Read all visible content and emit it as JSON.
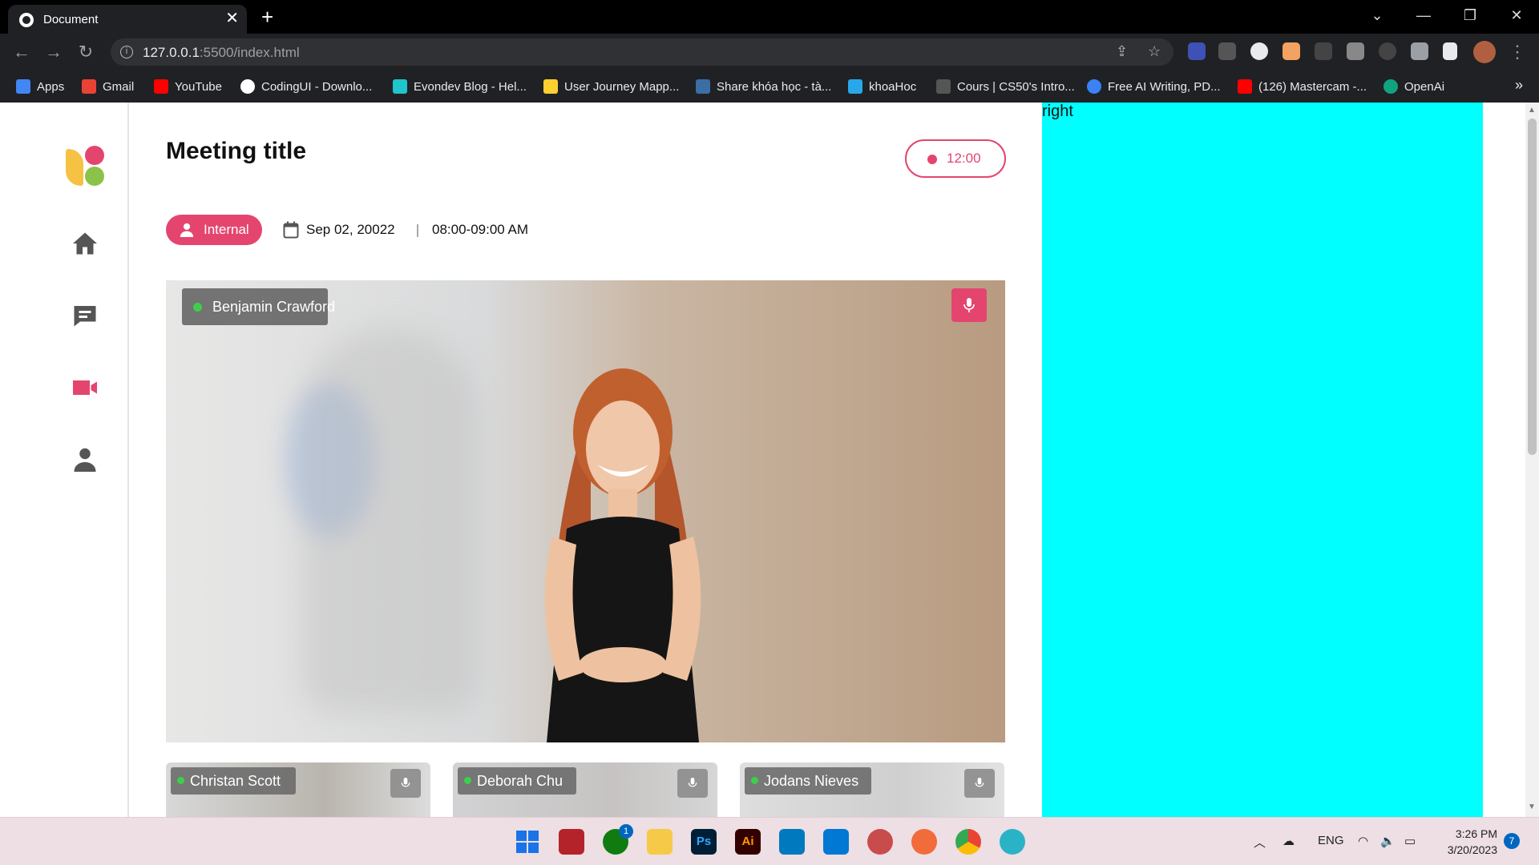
{
  "browser": {
    "tab_title": "Document",
    "tab_close": "✕",
    "new_tab": "+",
    "url_host": "127.0.0.1",
    "url_path": ":5500/index.html",
    "bookmarks": [
      {
        "label": "Apps",
        "icon": "apps-grid-icon",
        "color": "#4285f4"
      },
      {
        "label": "Gmail",
        "icon": "gmail-icon",
        "color": "#ea4335"
      },
      {
        "label": "YouTube",
        "icon": "youtube-icon",
        "color": "#ff0000"
      },
      {
        "label": "CodingUI - Downlo...",
        "icon": "codingui-icon",
        "color": "#ffffff"
      },
      {
        "label": "Evondev Blog - Hel...",
        "icon": "evondev-icon",
        "color": "#20c4cb"
      },
      {
        "label": "User Journey Mapp...",
        "icon": "miro-icon",
        "color": "#ffd02f"
      },
      {
        "label": "Share khóa học - tà...",
        "icon": "share-icon",
        "color": "#3a6ea5"
      },
      {
        "label": "khoaHoc",
        "icon": "onedrive-icon",
        "color": "#28a8ea"
      },
      {
        "label": "Cours | CS50's Intro...",
        "icon": "edx-icon",
        "color": "#bbbbbb"
      },
      {
        "label": "Free AI Writing, PD...",
        "icon": "ai-writing-icon",
        "color": "#3b82f6"
      },
      {
        "label": "(126) Mastercam -...",
        "icon": "youtube-icon",
        "color": "#ff0000"
      },
      {
        "label": "OpenAi",
        "icon": "openai-icon",
        "color": "#10a37f"
      }
    ],
    "bookmarks_more": "»"
  },
  "page": {
    "title": "Meeting title",
    "timer": "12:00",
    "badge": "Internal",
    "date": "Sep 02, 20022",
    "time_range": "08:00-09:00 AM",
    "right_label": "right",
    "accent_color": "#e4456f",
    "speaker": {
      "name": "Benjamin Crawford"
    },
    "participants": [
      {
        "name": "Christan Scott"
      },
      {
        "name": "Deborah Chu"
      },
      {
        "name": "Jodans Nieves"
      }
    ],
    "nav": [
      "home-icon",
      "chat-icon",
      "video-icon",
      "user-icon"
    ]
  },
  "taskbar": {
    "apps": [
      "windows-start-icon",
      "app-red-icon",
      "xbox-icon",
      "file-explorer-icon",
      "photoshop-icon",
      "illustrator-icon",
      "trello-icon",
      "vscode-icon",
      "app-spiral-icon",
      "app-orange-icon",
      "chrome-icon",
      "edge-dev-icon"
    ],
    "xbox_badge": "1",
    "photoshop": "Ps",
    "illustrator": "Ai",
    "language": "ENG",
    "time": "3:26 PM",
    "date": "3/20/2023",
    "notifications": "7"
  }
}
